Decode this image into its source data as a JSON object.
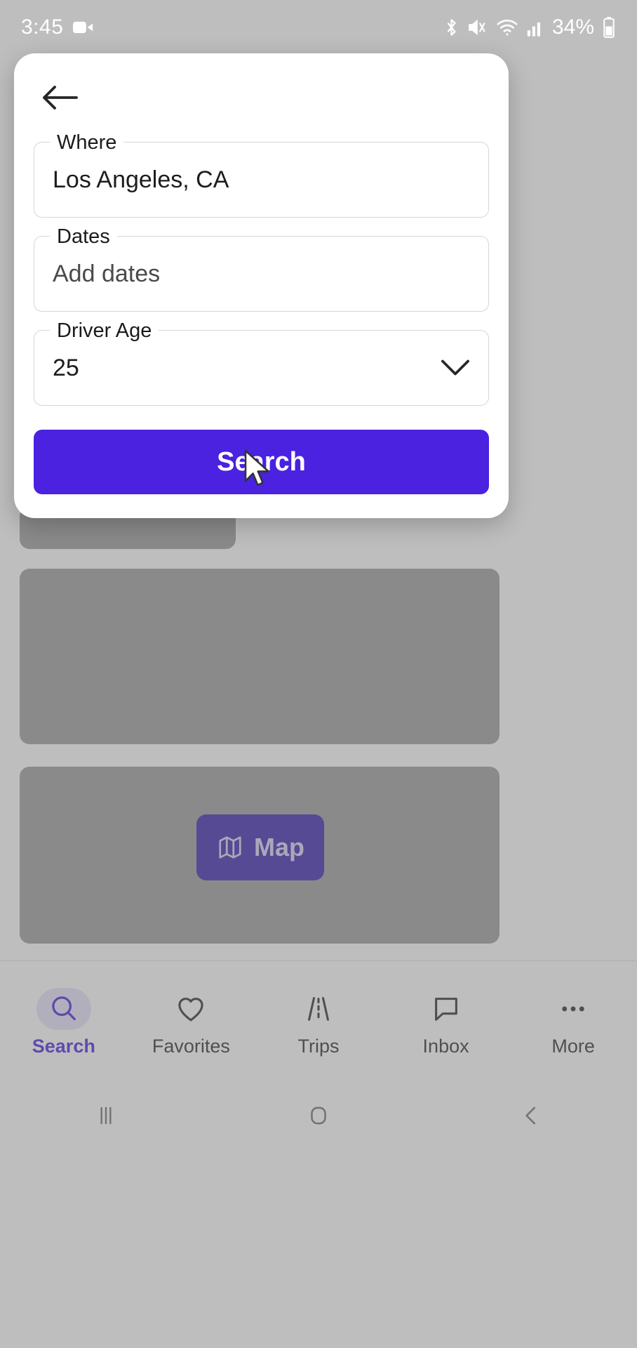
{
  "statusbar": {
    "time": "3:45",
    "battery_text": "34%",
    "icons": [
      "video-record-icon",
      "bluetooth-icon",
      "mute-vibrate-icon",
      "wifi-icon",
      "cellular-signal-icon",
      "battery-icon"
    ]
  },
  "sheet": {
    "back_icon": "back-arrow-icon",
    "fields": [
      {
        "label": "Where",
        "value": "Los Angeles, CA",
        "is_placeholder": false,
        "has_chevron": false
      },
      {
        "label": "Dates",
        "value": "Add dates",
        "is_placeholder": true,
        "has_chevron": false
      },
      {
        "label": "Driver Age",
        "value": "25",
        "is_placeholder": false,
        "has_chevron": true
      }
    ],
    "search_label": "Search"
  },
  "background": {
    "map_button": {
      "label": "Map",
      "icon": "map-fold-icon"
    }
  },
  "tabbar": {
    "items": [
      {
        "label": "Search",
        "icon": "search-icon",
        "active": true
      },
      {
        "label": "Favorites",
        "icon": "heart-icon",
        "active": false
      },
      {
        "label": "Trips",
        "icon": "road-icon",
        "active": false
      },
      {
        "label": "Inbox",
        "icon": "chat-bubble-icon",
        "active": false
      },
      {
        "label": "More",
        "icon": "ellipsis-icon",
        "active": false
      }
    ]
  },
  "navbar": {
    "buttons": [
      {
        "name": "recents-button",
        "icon": "recents-icon"
      },
      {
        "name": "home-button",
        "icon": "home-icon"
      },
      {
        "name": "back-button",
        "icon": "back-chevron-icon"
      }
    ]
  },
  "colors": {
    "accent": "#4a22e0",
    "map_button": "#3a21ae",
    "scrim": "rgba(120,120,120,0.48)"
  }
}
